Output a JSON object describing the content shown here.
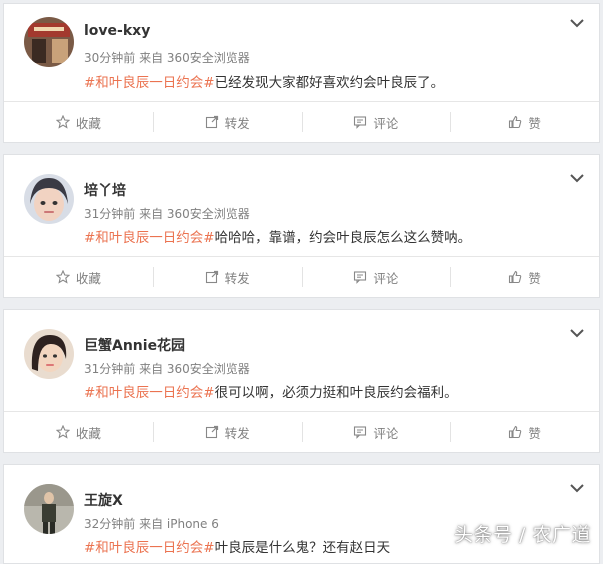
{
  "posts": [
    {
      "user": "love-kxy",
      "meta": "30分钟前 来自 360安全浏览器",
      "topic": "#和叶良辰一日约会#",
      "body": "已经发现大家都好喜欢约会叶良辰了。",
      "avatar_bg": "#6b4a3a"
    },
    {
      "user": "培丫培",
      "meta": "31分钟前 来自 360安全浏览器",
      "topic": "#和叶良辰一日约会#",
      "body": "哈哈哈，靠谱，约会叶良辰怎么这么赞呐。",
      "avatar_bg": "#5a6a8a"
    },
    {
      "user": "巨蟹Annie花园",
      "meta": "31分钟前 来自 360安全浏览器",
      "topic": "#和叶良辰一日约会#",
      "body": "很可以啊，必须力挺和叶良辰约会福利。",
      "avatar_bg": "#caa07f"
    },
    {
      "user": "王旋X",
      "meta": "32分钟前 来自 iPhone 6",
      "topic": "#和叶良辰一日约会#",
      "body": "叶良辰是什么鬼？还有赵日天",
      "avatar_bg": "#8a8a7a"
    }
  ],
  "actions": {
    "favorite": "收藏",
    "repost": "转发",
    "comment": "评论",
    "like": "赞"
  },
  "icons": {
    "favorite": "star-icon",
    "repost": "repost-icon",
    "comment": "comment-icon",
    "like": "thumbs-up-icon",
    "menu": "chevron-down-icon"
  },
  "colors": {
    "topic": "#eb7350",
    "meta": "#808080",
    "text": "#333333"
  },
  "watermark": "头条号 / 农广道"
}
